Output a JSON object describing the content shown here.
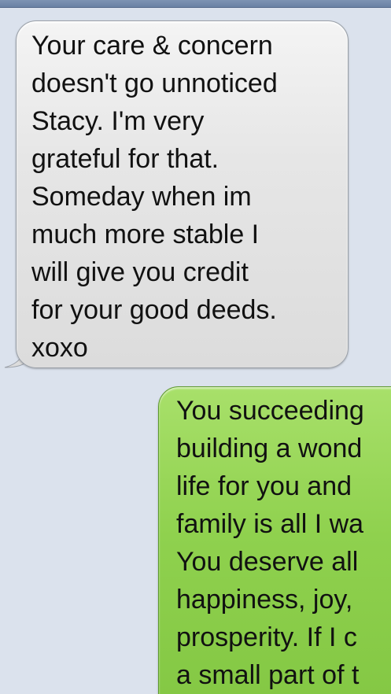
{
  "conversation": {
    "messages": [
      {
        "sender": "received",
        "text": "Your care & concern\ndoesn't go unnoticed\nStacy. I'm very\ngrateful for that.\nSomeday when im\nmuch more stable I\nwill give you credit\nfor your good deeds.\nxoxo"
      },
      {
        "sender": "sent",
        "text": "You succeeding\nbuilding a wond\nlife for you and\nfamily is all I wa\nYou deserve all\nhappiness, joy,\nprosperity. If I c\na small part of t"
      }
    ]
  },
  "colors": {
    "background": "#dbe2ed",
    "received_bubble": "#e6e6e6",
    "sent_bubble": "#8fd14e"
  }
}
